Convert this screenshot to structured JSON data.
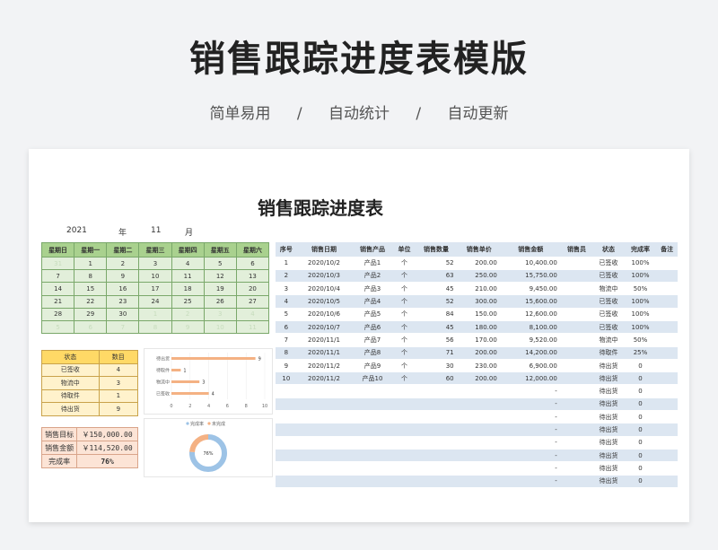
{
  "header": {
    "title": "销售跟踪进度表模版",
    "tags": [
      "简单易用",
      "自动统计",
      "自动更新"
    ],
    "separator": "/"
  },
  "sheet": {
    "title": "销售跟踪进度表",
    "year": "2021",
    "year_unit": "年",
    "month": "11",
    "month_unit": "月"
  },
  "calendar": {
    "headers": [
      "星期日",
      "星期一",
      "星期二",
      "星期三",
      "星期四",
      "星期五",
      "星期六"
    ],
    "rows": [
      [
        {
          "t": "31",
          "dim": true
        },
        {
          "t": "1"
        },
        {
          "t": "2"
        },
        {
          "t": "3"
        },
        {
          "t": "4"
        },
        {
          "t": "5"
        },
        {
          "t": "6"
        }
      ],
      [
        {
          "t": "7"
        },
        {
          "t": "8"
        },
        {
          "t": "9"
        },
        {
          "t": "10"
        },
        {
          "t": "11"
        },
        {
          "t": "12"
        },
        {
          "t": "13"
        }
      ],
      [
        {
          "t": "14"
        },
        {
          "t": "15"
        },
        {
          "t": "16"
        },
        {
          "t": "17"
        },
        {
          "t": "18"
        },
        {
          "t": "19"
        },
        {
          "t": "20"
        }
      ],
      [
        {
          "t": "21"
        },
        {
          "t": "22"
        },
        {
          "t": "23"
        },
        {
          "t": "24"
        },
        {
          "t": "25"
        },
        {
          "t": "26"
        },
        {
          "t": "27"
        }
      ],
      [
        {
          "t": "28"
        },
        {
          "t": "29"
        },
        {
          "t": "30"
        },
        {
          "t": "1",
          "dim": true
        },
        {
          "t": "2",
          "dim": true
        },
        {
          "t": "3",
          "dim": true
        },
        {
          "t": "4",
          "dim": true
        }
      ],
      [
        {
          "t": "5",
          "dim": true
        },
        {
          "t": "6",
          "dim": true
        },
        {
          "t": "7",
          "dim": true
        },
        {
          "t": "8",
          "dim": true
        },
        {
          "t": "9",
          "dim": true
        },
        {
          "t": "10",
          "dim": true
        },
        {
          "t": "11",
          "dim": true
        }
      ]
    ]
  },
  "status_table": {
    "headers": [
      "状态",
      "数目"
    ],
    "rows": [
      [
        "已签收",
        "4"
      ],
      [
        "物流中",
        "3"
      ],
      [
        "待取件",
        "1"
      ],
      [
        "待出货",
        "9"
      ]
    ]
  },
  "sales_summary": {
    "rows": [
      [
        "销售目标",
        "￥150,000.00"
      ],
      [
        "销售金额",
        "￥114,520.00"
      ],
      [
        "完成率",
        "76%"
      ]
    ]
  },
  "chart_data": [
    {
      "type": "bar",
      "orientation": "horizontal",
      "categories": [
        "待出货",
        "待取件",
        "物流中",
        "已签收"
      ],
      "values": [
        9,
        1,
        3,
        4
      ],
      "xlim": [
        0,
        10
      ],
      "xticks": [
        "0",
        "2",
        "4",
        "6",
        "8",
        "10"
      ],
      "color": "#f4b183"
    },
    {
      "type": "pie",
      "donut": true,
      "legend": [
        "完成率",
        "未完成"
      ],
      "values": [
        76,
        24
      ],
      "center_label": "76%",
      "colors": [
        "#9dc3e6",
        "#f4b183"
      ]
    }
  ],
  "data_table": {
    "headers": [
      "序号",
      "销售日期",
      "销售产品",
      "单位",
      "销售数量",
      "销售单价",
      "销售金额",
      "销售员",
      "状态",
      "完成率",
      "备注"
    ],
    "rows": [
      [
        "1",
        "2020/10/2",
        "产品1",
        "个",
        "52",
        "200.00",
        "10,400.00",
        "",
        "已签收",
        "100%",
        ""
      ],
      [
        "2",
        "2020/10/3",
        "产品2",
        "个",
        "63",
        "250.00",
        "15,750.00",
        "",
        "已签收",
        "100%",
        ""
      ],
      [
        "3",
        "2020/10/4",
        "产品3",
        "个",
        "45",
        "210.00",
        "9,450.00",
        "",
        "物流中",
        "50%",
        ""
      ],
      [
        "4",
        "2020/10/5",
        "产品4",
        "个",
        "52",
        "300.00",
        "15,600.00",
        "",
        "已签收",
        "100%",
        ""
      ],
      [
        "5",
        "2020/10/6",
        "产品5",
        "个",
        "84",
        "150.00",
        "12,600.00",
        "",
        "已签收",
        "100%",
        ""
      ],
      [
        "6",
        "2020/10/7",
        "产品6",
        "个",
        "45",
        "180.00",
        "8,100.00",
        "",
        "已签收",
        "100%",
        ""
      ],
      [
        "7",
        "2020/11/1",
        "产品7",
        "个",
        "56",
        "170.00",
        "9,520.00",
        "",
        "物流中",
        "50%",
        ""
      ],
      [
        "8",
        "2020/11/1",
        "产品8",
        "个",
        "71",
        "200.00",
        "14,200.00",
        "",
        "待取件",
        "25%",
        ""
      ],
      [
        "9",
        "2020/11/2",
        "产品9",
        "个",
        "30",
        "230.00",
        "6,900.00",
        "",
        "待出货",
        "0",
        ""
      ],
      [
        "10",
        "2020/11/2",
        "产品10",
        "个",
        "60",
        "200.00",
        "12,000.00",
        "",
        "待出货",
        "0",
        ""
      ],
      [
        "",
        "",
        "",
        "",
        "",
        "",
        "-",
        "",
        "待出货",
        "0",
        ""
      ],
      [
        "",
        "",
        "",
        "",
        "",
        "",
        "-",
        "",
        "待出货",
        "0",
        ""
      ],
      [
        "",
        "",
        "",
        "",
        "",
        "",
        "-",
        "",
        "待出货",
        "0",
        ""
      ],
      [
        "",
        "",
        "",
        "",
        "",
        "",
        "-",
        "",
        "待出货",
        "0",
        ""
      ],
      [
        "",
        "",
        "",
        "",
        "",
        "",
        "-",
        "",
        "待出货",
        "0",
        ""
      ],
      [
        "",
        "",
        "",
        "",
        "",
        "",
        "-",
        "",
        "待出货",
        "0",
        ""
      ],
      [
        "",
        "",
        "",
        "",
        "",
        "",
        "-",
        "",
        "待出货",
        "0",
        ""
      ],
      [
        "",
        "",
        "",
        "",
        "",
        "",
        "-",
        "",
        "待出货",
        "0",
        ""
      ]
    ]
  }
}
